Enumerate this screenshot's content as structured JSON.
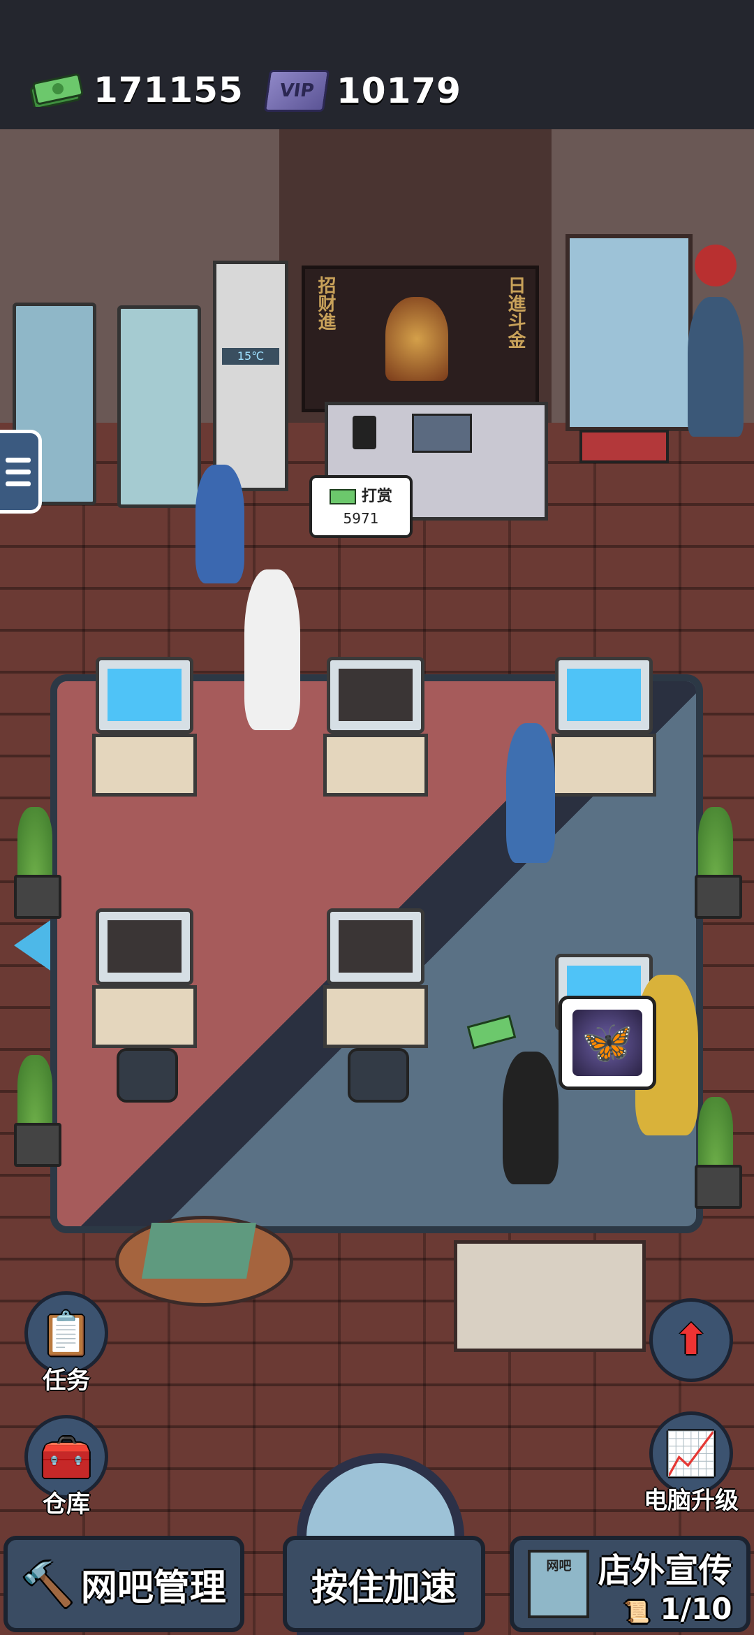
{
  "top_bar": {
    "cash": "171155",
    "vip_points": "10179",
    "cash_icon": "cash-stack-icon",
    "vip_icon": "vip-card-icon",
    "vip_icon_text": "VIP"
  },
  "scene": {
    "tip_bubble": {
      "label": "打赏",
      "amount": "5971"
    },
    "shrine_left_text": "招财進",
    "shrine_right_text": "日進斗金",
    "thermostat": "15℃",
    "cafe_sign": "网吧"
  },
  "side_buttons": {
    "tasks": "任务",
    "warehouse": "仓库",
    "pc_upgrade": "电脑升级"
  },
  "bottom_bar": {
    "manage": "网吧管理",
    "speed_up": "按住加速",
    "promo": "店外宣传",
    "promo_progress": "1/10"
  },
  "colors": {
    "accent_blue": "#4db8e8",
    "button_bg": "#3a4c63",
    "cash_green": "#5cb85c"
  }
}
